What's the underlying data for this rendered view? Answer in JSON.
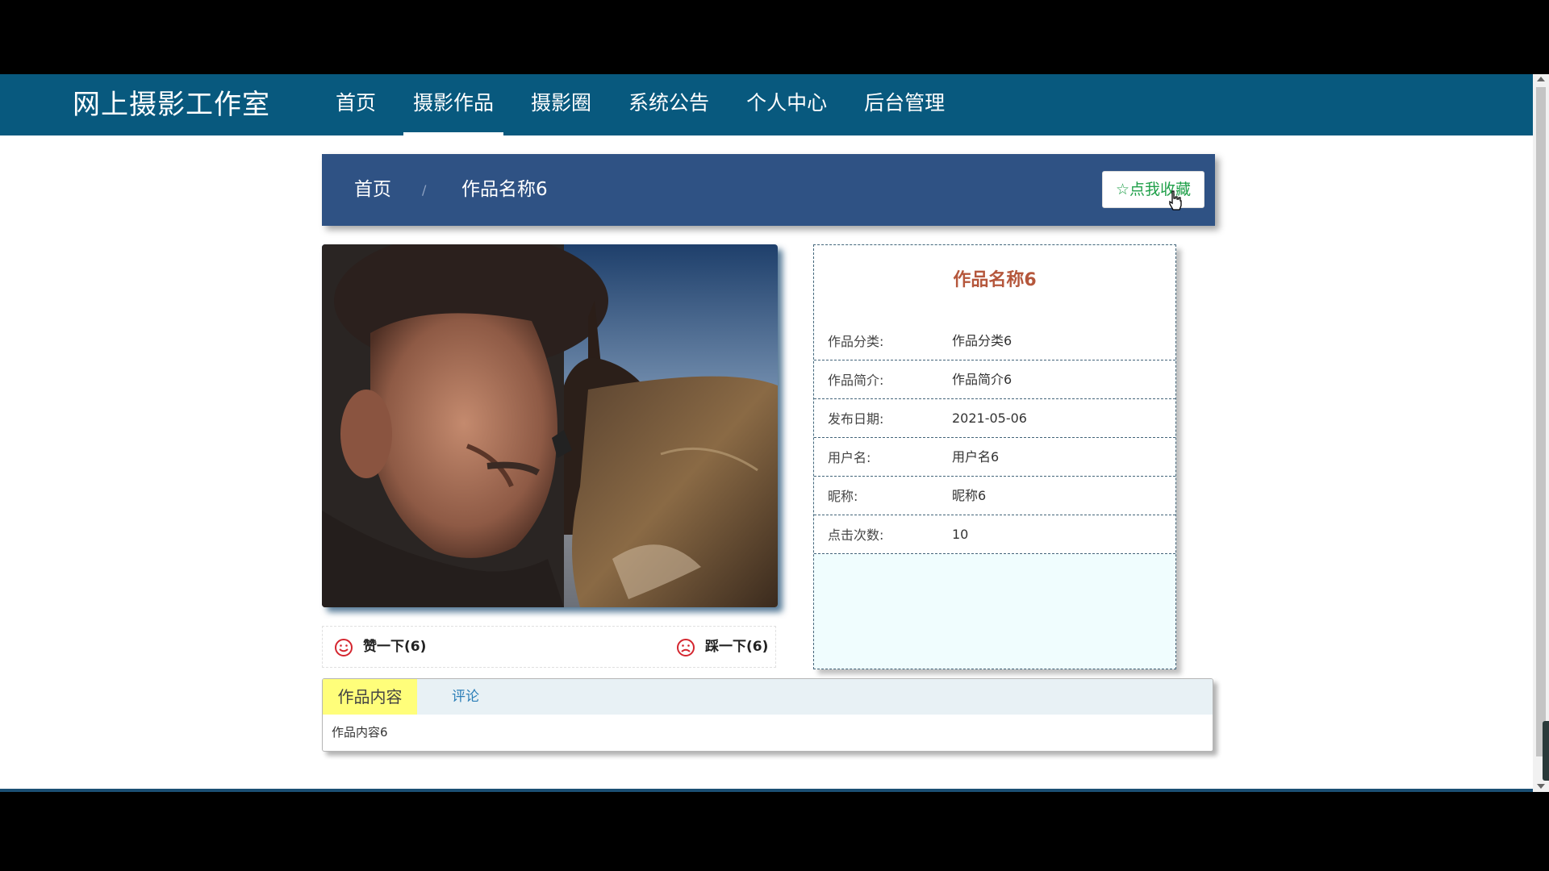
{
  "site": {
    "title": "网上摄影工作室"
  },
  "nav": {
    "items": [
      {
        "label": "首页"
      },
      {
        "label": "摄影作品"
      },
      {
        "label": "摄影圈"
      },
      {
        "label": "系统公告"
      },
      {
        "label": "个人中心"
      },
      {
        "label": "后台管理"
      }
    ],
    "active": "摄影作品"
  },
  "breadcrumb": {
    "home": "首页",
    "separator": "/",
    "current": "作品名称6"
  },
  "favorite_button": {
    "icon": "star-outline-icon",
    "label": "点我收藏"
  },
  "photo": {
    "description_icon": "photo-image"
  },
  "votes": {
    "like": {
      "label": "赞一下(6)",
      "icon": "smile-icon"
    },
    "dislike": {
      "label": "踩一下(6)",
      "icon": "frown-icon"
    }
  },
  "detail": {
    "title": "作品名称6",
    "rows": [
      {
        "label": "作品分类:",
        "value": "作品分类6"
      },
      {
        "label": "作品简介:",
        "value": "作品简介6"
      },
      {
        "label": "发布日期:",
        "value": "2021-05-06"
      },
      {
        "label": "用户名:",
        "value": "用户名6"
      },
      {
        "label": "昵称:",
        "value": "昵称6"
      },
      {
        "label": "点击次数:",
        "value": "10"
      }
    ]
  },
  "tabs": {
    "items": [
      {
        "label": "作品内容"
      },
      {
        "label": "评论"
      }
    ],
    "content": "作品内容6"
  },
  "colors": {
    "navbar": "#08597e",
    "breadcrumb_bar": "#2f5284",
    "favorite_text": "#20a04a",
    "detail_title": "#b5573c",
    "vote_icon": "#d4262f",
    "active_tab": "#fffe7a"
  }
}
